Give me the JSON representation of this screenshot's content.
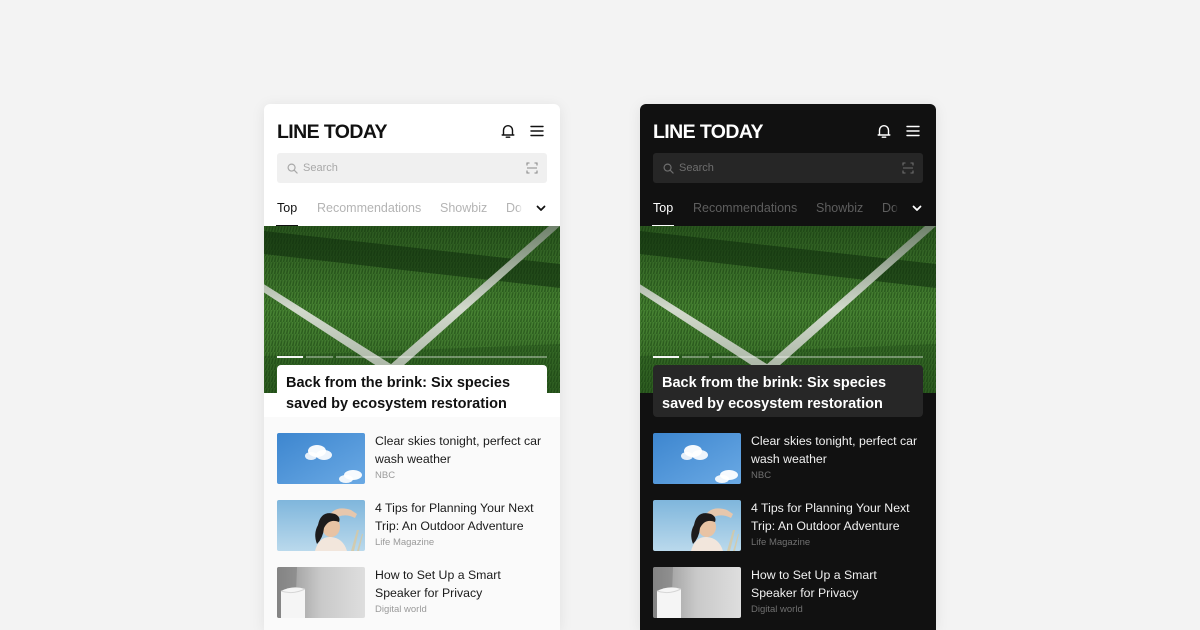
{
  "app": {
    "title": "LINE TODAY"
  },
  "search": {
    "placeholder": "Search"
  },
  "tabs": [
    "Top",
    "Recommendations",
    "Showbiz",
    "Do"
  ],
  "hero": {
    "title_line1": "Back from the brink: Six species",
    "title_line2": "saved by ecosystem restoration",
    "slides_total": 3,
    "slide_active": 1
  },
  "articles": [
    {
      "title_line1": "Clear skies tonight, perfect car",
      "title_line2": "wash weather",
      "source": "NBC"
    },
    {
      "title_line1": "4 Tips for Planning Your Next",
      "title_line2": "Trip: An Outdoor Adventure",
      "source": "Life Magazine"
    },
    {
      "title_line1": "How to Set Up a Smart",
      "title_line2": "Speaker for Privacy",
      "source": "Digital world"
    }
  ],
  "themes": [
    "light",
    "dark"
  ],
  "colors": {
    "light_bg": "#ffffff",
    "dark_bg": "#111111",
    "page_bg": "#f3f3f3"
  },
  "icons": [
    "bell-icon",
    "menu-icon",
    "search-icon",
    "scan-icon",
    "chevron-down-icon"
  ]
}
